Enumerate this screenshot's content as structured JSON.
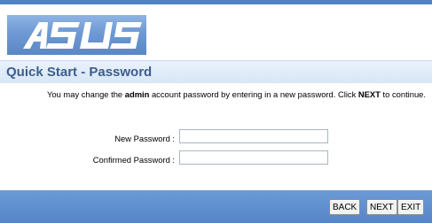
{
  "header": {
    "logo_alt": "ASUS",
    "brand_colors": {
      "strip": "#4f83c4",
      "logo_bg": "#6e99d4",
      "bar": "#5684c7"
    }
  },
  "page": {
    "title": "Quick Start - Password"
  },
  "description": {
    "part1": "You may change the ",
    "bold1": "admin",
    "part2": " account password by entering in a new password. Click ",
    "bold2": "NEXT",
    "part3": " to continue."
  },
  "form": {
    "new_password_label": "New Password :",
    "new_password_value": "",
    "confirmed_password_label": "Confirmed Password :",
    "confirmed_password_value": ""
  },
  "buttons": {
    "back": "BACK",
    "next": "NEXT",
    "exit": "EXIT"
  }
}
